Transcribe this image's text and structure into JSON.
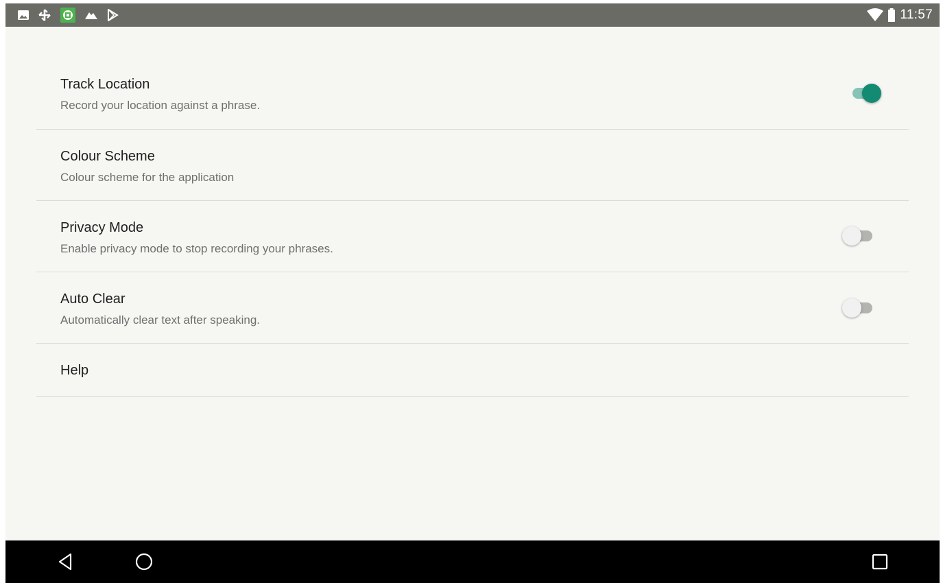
{
  "status_bar": {
    "time": "11:57",
    "left_icons": [
      "image-icon",
      "transfer-icon",
      "app-icon",
      "mountain-icon",
      "play-store-icon"
    ],
    "right_icons": [
      "wifi-icon",
      "battery-icon"
    ]
  },
  "settings": {
    "items": [
      {
        "title": "Track Location",
        "summary": "Record your location against a phrase.",
        "switch": true
      },
      {
        "title": "Colour Scheme",
        "summary": "Colour scheme for the application"
      },
      {
        "title": "Privacy Mode",
        "summary": "Enable privacy mode to stop recording your phrases.",
        "switch": false
      },
      {
        "title": "Auto Clear",
        "summary": "Automatically clear text after speaking.",
        "switch": false
      },
      {
        "title": "Help"
      }
    ]
  },
  "colors": {
    "status_bar": "#6b6b66",
    "background": "#f6f6f2",
    "accent": "#138a72",
    "nav_bar": "#000000"
  },
  "navigation": {
    "buttons": [
      "back-icon",
      "home-icon",
      "recents-icon"
    ]
  }
}
